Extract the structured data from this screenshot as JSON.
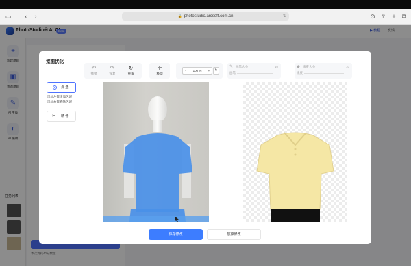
{
  "browser": {
    "url": "photostudio.arcsoft.com.cn"
  },
  "app": {
    "title": "PhotoStudio® AI CL",
    "badge": "Beta",
    "header_right_1": "▶ 教程",
    "header_right_2": "反馈"
  },
  "sidebar": {
    "items": [
      {
        "label": "新建项目",
        "icon": "plus-icon"
      },
      {
        "label": "我的项目",
        "icon": "image-icon"
      },
      {
        "label": "AI 生成",
        "icon": "brush-icon"
      },
      {
        "label": "AI 编辑",
        "icon": "palette-icon"
      }
    ],
    "history_label": "任务列表",
    "credits": "本次消耗40分数量"
  },
  "modal": {
    "title": "抠图优化",
    "tools": {
      "undo": "撤销",
      "redo": "恢复",
      "reset": "重置",
      "move": "移动",
      "zoom_value": "100 %",
      "zoom_minus": "-",
      "zoom_plus": "+"
    },
    "brush": {
      "label": "画笔大小",
      "value": "10",
      "sub": "画笔"
    },
    "eraser": {
      "label": "橡皮大小",
      "value": "10",
      "sub": "橡皮"
    },
    "modes": {
      "point": "点 选",
      "brush": "精 修"
    },
    "hints": {
      "add": "鼠标左键增加区域",
      "remove": "鼠标右键去除区域"
    },
    "buttons": {
      "save": "保存修改",
      "discard": "放弃修改"
    }
  },
  "colors": {
    "accent": "#3d7dff",
    "mask": "#4a90e8",
    "garment": "#f5e7a5"
  }
}
